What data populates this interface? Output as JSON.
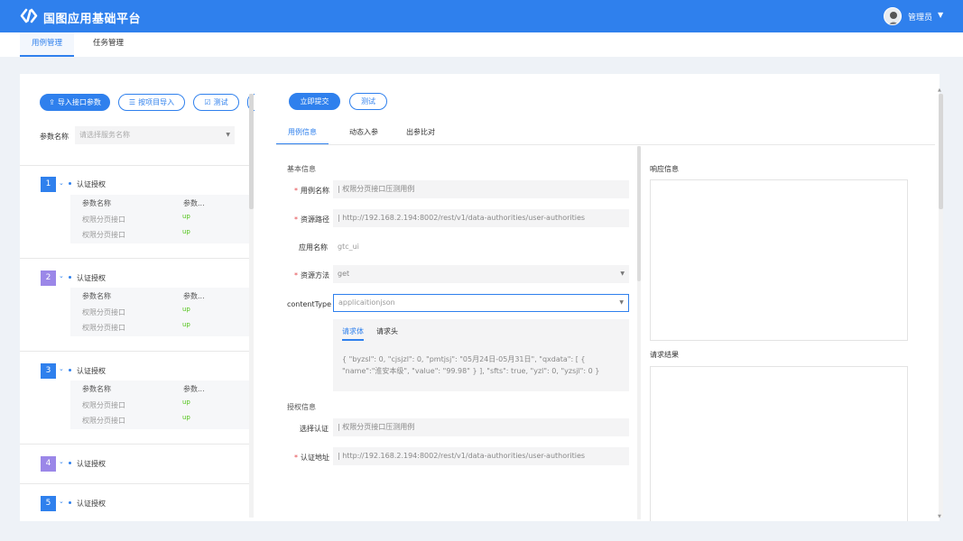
{
  "app": {
    "title": "国图应用基础平台"
  },
  "user": {
    "name": "管理员",
    "caret": "▼"
  },
  "top_tabs": [
    {
      "label": "用例管理",
      "active": true
    },
    {
      "label": "任务管理",
      "active": false
    }
  ],
  "left_panel": {
    "buttons": {
      "import_params": "导入接口参数",
      "import_by_project": "按项目导入",
      "test": "测试"
    },
    "param_name_label": "参数名称",
    "param_select_placeholder": "请选择服务名称",
    "cases": [
      {
        "num": "1",
        "title": "认证授权",
        "expanded": true,
        "color": "#2f80ed",
        "header": [
          "参数名称",
          "参数..."
        ],
        "rows": [
          {
            "name": "权限分页接口",
            "value": "up"
          },
          {
            "name": "权限分页接口",
            "value": "up"
          }
        ]
      },
      {
        "num": "2",
        "title": "认证授权",
        "expanded": true,
        "color": "#9b87e8",
        "header": [
          "参数名称",
          "参数..."
        ],
        "rows": [
          {
            "name": "权限分页接口",
            "value": "up"
          },
          {
            "name": "权限分页接口",
            "value": "up"
          }
        ]
      },
      {
        "num": "3",
        "title": "认证授权",
        "expanded": true,
        "color": "#2f80ed",
        "header": [
          "参数名称",
          "参数..."
        ],
        "rows": [
          {
            "name": "权限分页接口",
            "value": "up"
          },
          {
            "name": "权限分页接口",
            "value": "up"
          }
        ]
      },
      {
        "num": "4",
        "title": "认证授权",
        "expanded": false,
        "color": "#9b87e8"
      },
      {
        "num": "5",
        "title": "认证授权",
        "expanded": false,
        "color": "#2f80ed"
      }
    ]
  },
  "center_panel": {
    "buttons": {
      "submit": "立即提交",
      "test": "测试"
    },
    "sub_tabs": [
      {
        "label": "用例信息",
        "active": true
      },
      {
        "label": "动态入参",
        "active": false
      },
      {
        "label": "出参比对",
        "active": false
      }
    ],
    "basic_info_title": "基本信息",
    "fields": {
      "case_name": {
        "label": "用例名称",
        "required": "*",
        "value": "| 权限分页接口压测用例"
      },
      "resource_path": {
        "label": "资源路径",
        "required": "*",
        "value": "| http://192.168.2.194:8002/rest/v1/data-authorities/user-authorities"
      },
      "app_name": {
        "label": "应用名称",
        "value": "gtc_ui"
      },
      "resource_method": {
        "label": "资源方法",
        "required": "*",
        "value": "get"
      },
      "content_type": {
        "label": "contentType",
        "value": "applicaitionjson"
      }
    },
    "request_tabs": {
      "body": "请求体",
      "header": "请求头"
    },
    "request_body": "{ \"byzsl\": 0, \"cjsjzl\": 0, \"pmtjsj\": \"05月24日-05月31日\", \"qxdata\": [ { \"name\":\"淮安本级\", \"value\": \"99.98\" } ], \"sfts\": true, \"yzl\": 0, \"yzsjl\": 0 }",
    "auth_info_title": "授权信息",
    "auth_fields": {
      "auth_select": {
        "label": "选择认证",
        "value": "| 权限分页接口压测用例"
      },
      "auth_url": {
        "label": "认证地址",
        "required": "*",
        "value": "| http://192.168.2.194:8002/rest/v1/data-authorities/user-authorities"
      }
    }
  },
  "right_panel": {
    "response_title": "响应信息",
    "result_title": "请求结果"
  },
  "colors": {
    "primary": "#2f80ed",
    "purple": "#9b87e8",
    "success": "#52c41a",
    "required": "#e5484d"
  },
  "icons": [
    "logo-icon",
    "upload-icon",
    "list-icon",
    "edit-icon",
    "chevron-down-icon",
    "select-caret-icon"
  ]
}
